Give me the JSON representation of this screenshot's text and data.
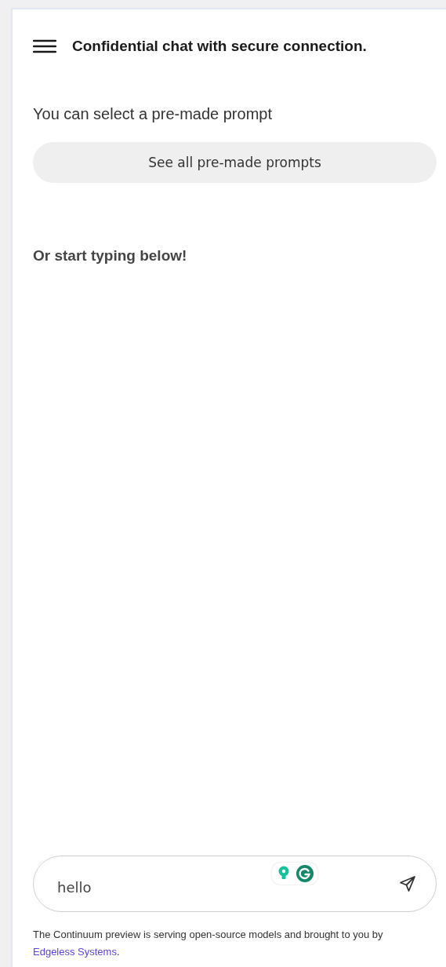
{
  "header": {
    "title": "Confidential chat with secure connection."
  },
  "prompt_intro": "You can select a pre-made prompt",
  "prompts_button": "See all pre-made prompts",
  "typing_hint": "Or start typing below!",
  "composer": {
    "value": "hello"
  },
  "footer": {
    "text": "The Continuum preview is serving open-source models and brought to you by ",
    "link": "Edgeless Systems",
    "end": "."
  }
}
